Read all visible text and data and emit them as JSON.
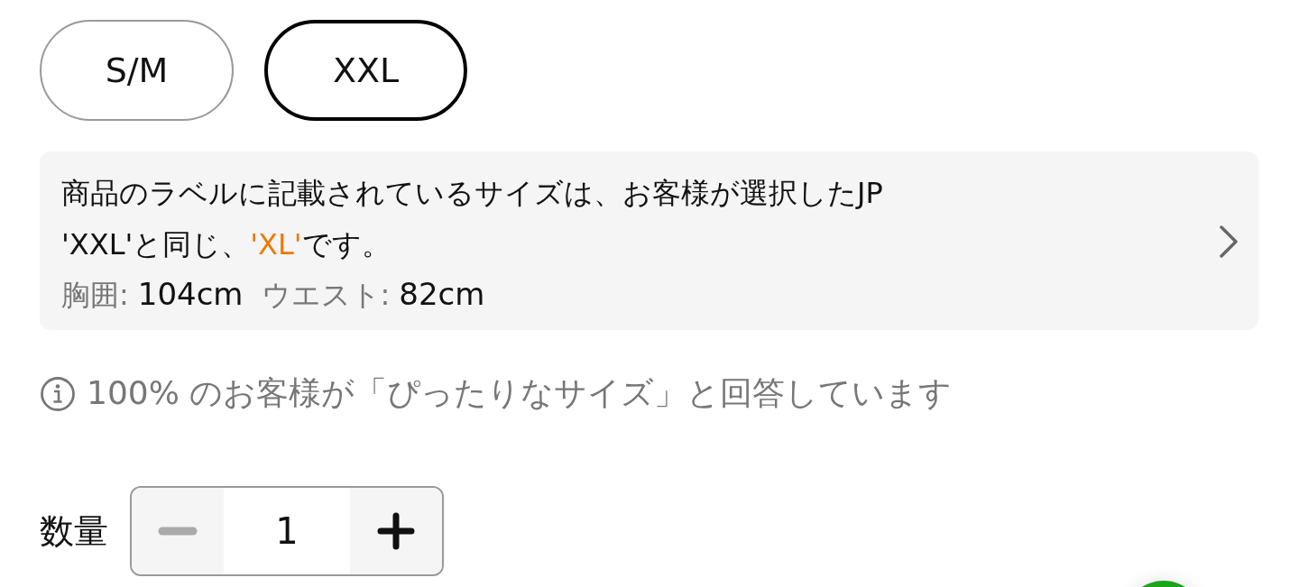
{
  "sizes": [
    {
      "label": "S/M",
      "selected": false
    },
    {
      "label": "XXL",
      "selected": true
    }
  ],
  "size_note": {
    "lines": [
      [
        {
          "text": "商品のラベルに記載されているサイズは、お客様が選択したJP",
          "highlight": false
        }
      ],
      [
        {
          "text": "'XXL'と同じ、",
          "highlight": false
        },
        {
          "text": "'XL'",
          "highlight": true
        },
        {
          "text": "です。",
          "highlight": false
        }
      ]
    ],
    "measurements": [
      {
        "label": "胸囲:",
        "value": "104cm"
      },
      {
        "label": "ウエスト:",
        "value": "82cm"
      }
    ]
  },
  "fit_info": "100% のお客様が「ぴったりなサイズ」と回答しています",
  "quantity": {
    "label": "数量",
    "value": "1",
    "minus_disabled": true,
    "plus_disabled": false
  }
}
